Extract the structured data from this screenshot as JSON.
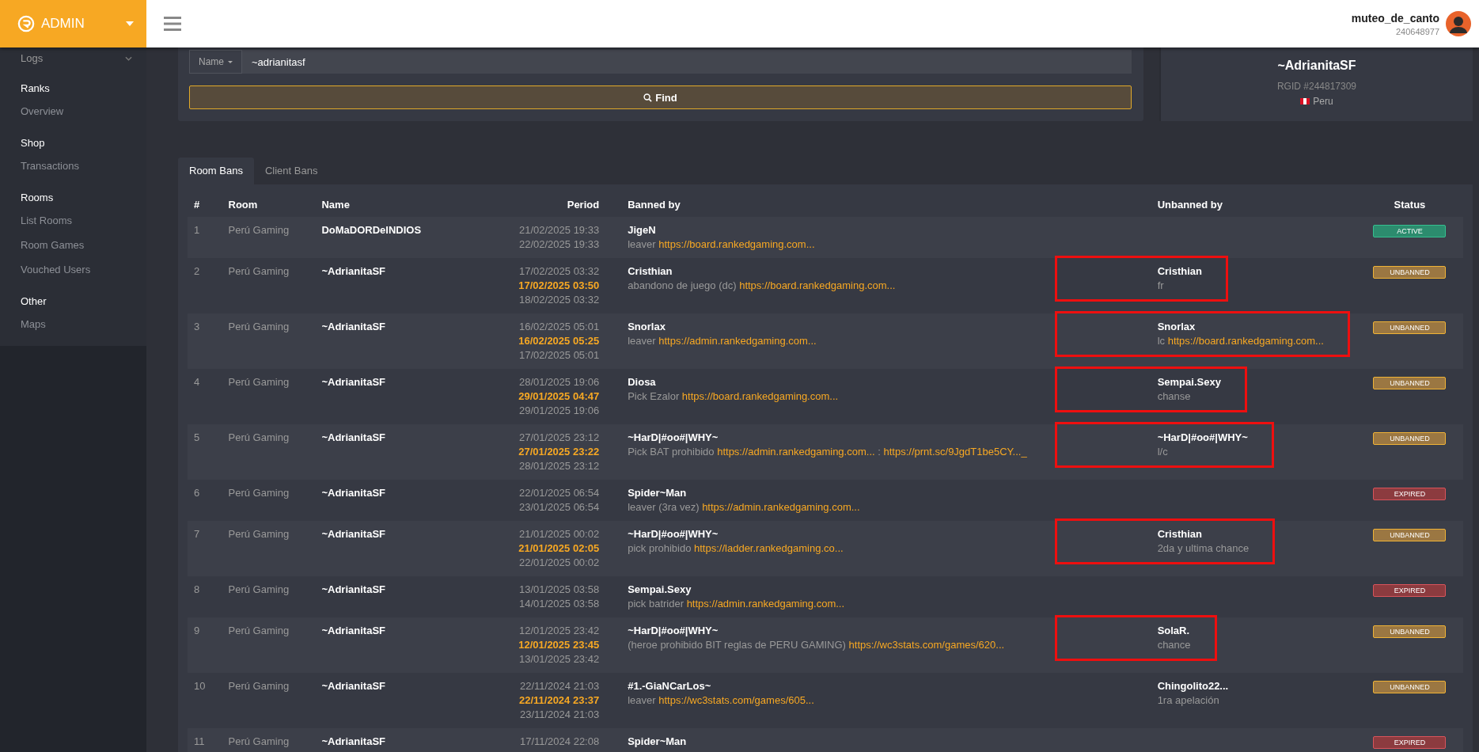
{
  "brand": {
    "label": "ADMIN"
  },
  "user": {
    "name": "muteo_de_canto",
    "id": "240648977"
  },
  "sidebar": {
    "sections": [
      {
        "title": "Logs"
      },
      {
        "title": "Ranks",
        "items": [
          "Overview"
        ]
      },
      {
        "title": "Shop",
        "items": [
          "Transactions"
        ]
      },
      {
        "title": "Rooms",
        "items": [
          "List Rooms",
          "Room Games",
          "Vouched Users"
        ]
      },
      {
        "title": "Other",
        "items": [
          "Maps"
        ]
      }
    ]
  },
  "search": {
    "field_menu": "Name",
    "value": "~adrianitasf",
    "button": "Find"
  },
  "profile": {
    "name": "~AdrianitaSF",
    "rgid": "RGID #244817309",
    "country": "Peru"
  },
  "tabs": [
    {
      "label": "Room Bans",
      "selected": true
    },
    {
      "label": "Client Bans",
      "selected": false
    }
  ],
  "table": {
    "columns": [
      "#",
      "Room",
      "Name",
      "Period",
      "Banned by",
      "Unbanned by",
      "Status"
    ],
    "rows": [
      {
        "num": "1",
        "room": "Perú Gaming",
        "name": "DoMaDORDeINDIOS",
        "period": [
          {
            "kind": "start",
            "text": "21/02/2025 19:33"
          },
          {
            "kind": "end",
            "text": "22/02/2025 19:33"
          }
        ],
        "banned_by": {
          "name": "JigeN",
          "reason": [
            {
              "kind": "text",
              "text": "leaver"
            },
            {
              "kind": "link",
              "text": "https://board.rankedgaming.com..."
            }
          ]
        },
        "status": {
          "kind": "active",
          "label": "ACTIVE"
        }
      },
      {
        "num": "2",
        "room": "Perú Gaming",
        "name": "~AdrianitaSF",
        "period": [
          {
            "kind": "start",
            "text": "17/02/2025 03:32"
          },
          {
            "kind": "unbanned",
            "text": "17/02/2025 03:50"
          },
          {
            "kind": "end",
            "text": "18/02/2025 03:32"
          }
        ],
        "banned_by": {
          "name": "Cristhian",
          "reason": [
            {
              "kind": "text",
              "text": "abandono de juego (dc)"
            },
            {
              "kind": "link",
              "text": "https://board.rankedgaming.com..."
            }
          ]
        },
        "unbanned_by": {
          "name": "Cristhian",
          "reason": [
            {
              "kind": "text",
              "text": "fr"
            }
          ],
          "marked": true
        },
        "status": {
          "kind": "unbanned",
          "label": "UNBANNED"
        }
      },
      {
        "num": "3",
        "room": "Perú Gaming",
        "name": "~AdrianitaSF",
        "period": [
          {
            "kind": "start",
            "text": "16/02/2025 05:01"
          },
          {
            "kind": "unbanned",
            "text": "16/02/2025 05:25"
          },
          {
            "kind": "end",
            "text": "17/02/2025 05:01"
          }
        ],
        "banned_by": {
          "name": "Snorlax",
          "reason": [
            {
              "kind": "text",
              "text": "leaver"
            },
            {
              "kind": "link",
              "text": "https://admin.rankedgaming.com..."
            }
          ]
        },
        "unbanned_by": {
          "name": "Snorlax",
          "reason": [
            {
              "kind": "text",
              "text": "lc"
            },
            {
              "kind": "link",
              "text": "https://board.rankedgaming.com..."
            }
          ],
          "marked": true
        },
        "status": {
          "kind": "unbanned",
          "label": "UNBANNED"
        }
      },
      {
        "num": "4",
        "room": "Perú Gaming",
        "name": "~AdrianitaSF",
        "period": [
          {
            "kind": "start",
            "text": "28/01/2025 19:06"
          },
          {
            "kind": "unbanned",
            "text": "29/01/2025 04:47"
          },
          {
            "kind": "end",
            "text": "29/01/2025 19:06"
          }
        ],
        "banned_by": {
          "name": "Diosa",
          "reason": [
            {
              "kind": "text",
              "text": "Pick Ezalor"
            },
            {
              "kind": "link",
              "text": "https://board.rankedgaming.com..."
            }
          ]
        },
        "unbanned_by": {
          "name": "Sempai.Sexy",
          "reason": [
            {
              "kind": "text",
              "text": "chanse"
            }
          ],
          "marked": true
        },
        "status": {
          "kind": "unbanned",
          "label": "UNBANNED"
        }
      },
      {
        "num": "5",
        "room": "Perú Gaming",
        "name": "~AdrianitaSF",
        "period": [
          {
            "kind": "start",
            "text": "27/01/2025 23:12"
          },
          {
            "kind": "unbanned",
            "text": "27/01/2025 23:22"
          },
          {
            "kind": "end",
            "text": "28/01/2025 23:12"
          }
        ],
        "banned_by": {
          "name": "~HarD|#oo#|WHY~",
          "reason": [
            {
              "kind": "text",
              "text": "Pick BAT prohibido"
            },
            {
              "kind": "link",
              "text": "https://admin.rankedgaming.com..."
            },
            {
              "kind": "text",
              "text": ":"
            },
            {
              "kind": "link",
              "text": "https://prnt.sc/9JgdT1be5CY..._"
            }
          ]
        },
        "unbanned_by": {
          "name": "~HarD|#oo#|WHY~",
          "reason": [
            {
              "kind": "text",
              "text": "l/c"
            }
          ],
          "marked": true
        },
        "status": {
          "kind": "unbanned",
          "label": "UNBANNED"
        }
      },
      {
        "num": "6",
        "room": "Perú Gaming",
        "name": "~AdrianitaSF",
        "period": [
          {
            "kind": "start",
            "text": "22/01/2025 06:54"
          },
          {
            "kind": "end",
            "text": "23/01/2025 06:54"
          }
        ],
        "banned_by": {
          "name": "Spider~Man",
          "reason": [
            {
              "kind": "text",
              "text": "leaver (3ra vez)"
            },
            {
              "kind": "link",
              "text": "https://admin.rankedgaming.com..."
            }
          ]
        },
        "status": {
          "kind": "expired",
          "label": "EXPIRED"
        }
      },
      {
        "num": "7",
        "room": "Perú Gaming",
        "name": "~AdrianitaSF",
        "period": [
          {
            "kind": "start",
            "text": "21/01/2025 00:02"
          },
          {
            "kind": "unbanned",
            "text": "21/01/2025 02:05"
          },
          {
            "kind": "end",
            "text": "22/01/2025 00:02"
          }
        ],
        "banned_by": {
          "name": "~HarD|#oo#|WHY~",
          "reason": [
            {
              "kind": "text",
              "text": "pick prohibido"
            },
            {
              "kind": "link",
              "text": "https://ladder.rankedgaming.co..."
            }
          ]
        },
        "unbanned_by": {
          "name": "Cristhian",
          "reason": [
            {
              "kind": "text",
              "text": "2da y ultima chance"
            }
          ],
          "marked": true
        },
        "status": {
          "kind": "unbanned",
          "label": "UNBANNED"
        }
      },
      {
        "num": "8",
        "room": "Perú Gaming",
        "name": "~AdrianitaSF",
        "period": [
          {
            "kind": "start",
            "text": "13/01/2025 03:58"
          },
          {
            "kind": "end",
            "text": "14/01/2025 03:58"
          }
        ],
        "banned_by": {
          "name": "Sempai.Sexy",
          "reason": [
            {
              "kind": "text",
              "text": "pick batrider"
            },
            {
              "kind": "link",
              "text": "https://admin.rankedgaming.com..."
            }
          ]
        },
        "status": {
          "kind": "expired",
          "label": "EXPIRED"
        }
      },
      {
        "num": "9",
        "room": "Perú Gaming",
        "name": "~AdrianitaSF",
        "period": [
          {
            "kind": "start",
            "text": "12/01/2025 23:42"
          },
          {
            "kind": "unbanned",
            "text": "12/01/2025 23:45"
          },
          {
            "kind": "end",
            "text": "13/01/2025 23:42"
          }
        ],
        "banned_by": {
          "name": "~HarD|#oo#|WHY~",
          "reason": [
            {
              "kind": "text",
              "text": "(heroe prohibido BIT reglas de PERU GAMING)"
            },
            {
              "kind": "link",
              "text": "https://wc3stats.com/games/620..."
            }
          ]
        },
        "unbanned_by": {
          "name": "SolaR.",
          "reason": [
            {
              "kind": "text",
              "text": "chance"
            }
          ],
          "marked": true
        },
        "status": {
          "kind": "unbanned",
          "label": "UNBANNED"
        }
      },
      {
        "num": "10",
        "room": "Perú Gaming",
        "name": "~AdrianitaSF",
        "period": [
          {
            "kind": "start",
            "text": "22/11/2024 21:03"
          },
          {
            "kind": "unbanned",
            "text": "22/11/2024 23:37"
          },
          {
            "kind": "end",
            "text": "23/11/2024 21:03"
          }
        ],
        "banned_by": {
          "name": "#1.-GiaNCarLos~",
          "reason": [
            {
              "kind": "text",
              "text": "leaver"
            },
            {
              "kind": "link",
              "text": "https://wc3stats.com/games/605..."
            }
          ]
        },
        "unbanned_by": {
          "name": "Chingolito22...",
          "reason": [
            {
              "kind": "text",
              "text": "1ra apelación"
            }
          ],
          "marked": false
        },
        "status": {
          "kind": "unbanned",
          "label": "UNBANNED"
        }
      },
      {
        "num": "11",
        "room": "Perú Gaming",
        "name": "~AdrianitaSF",
        "period": [
          {
            "kind": "start",
            "text": "17/11/2024 22:08"
          }
        ],
        "banned_by": {
          "name": "Spider~Man"
        },
        "status": {
          "kind": "expired",
          "label": "EXPIRED"
        }
      }
    ]
  }
}
